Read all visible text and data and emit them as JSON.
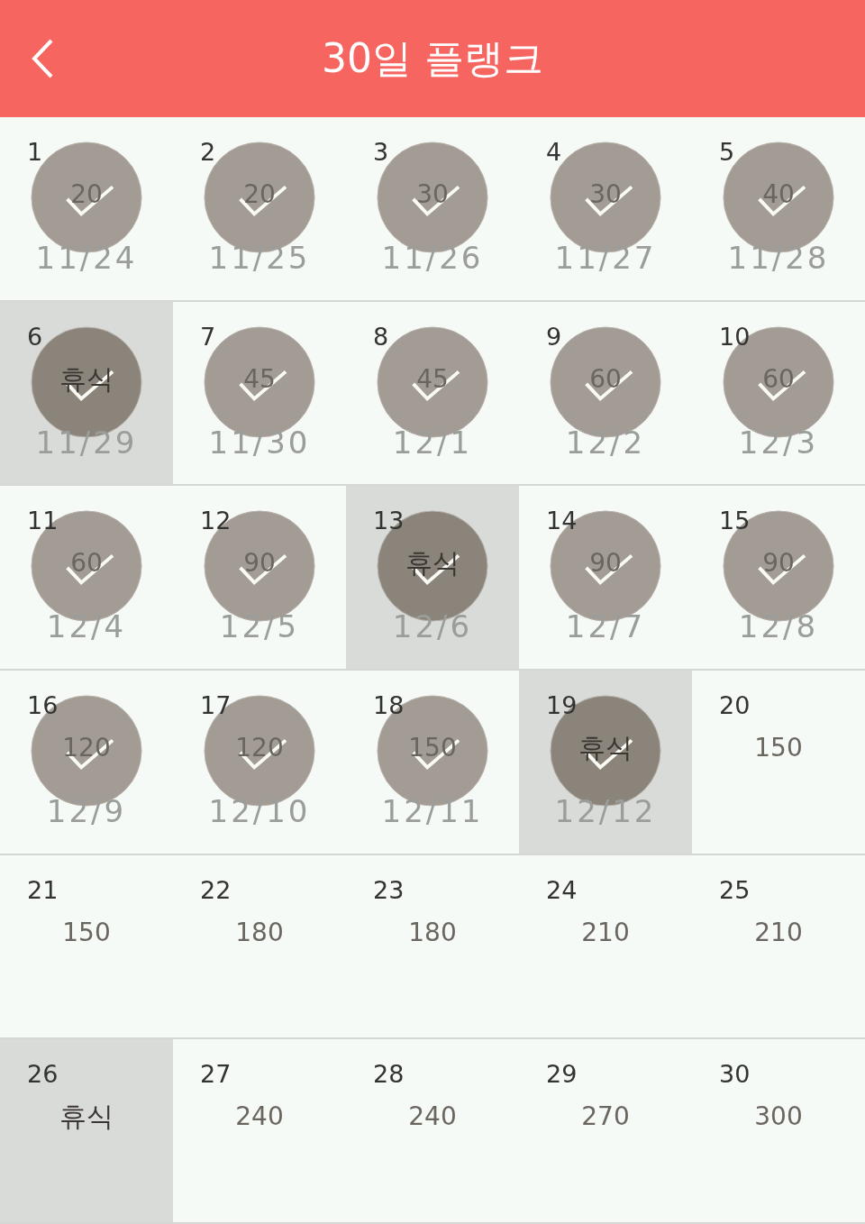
{
  "header": {
    "title": "30일 플랭크"
  },
  "days": [
    {
      "day": "1",
      "goal": "20",
      "date": "11/24",
      "done": true,
      "rest": false
    },
    {
      "day": "2",
      "goal": "20",
      "date": "11/25",
      "done": true,
      "rest": false
    },
    {
      "day": "3",
      "goal": "30",
      "date": "11/26",
      "done": true,
      "rest": false
    },
    {
      "day": "4",
      "goal": "30",
      "date": "11/27",
      "done": true,
      "rest": false
    },
    {
      "day": "5",
      "goal": "40",
      "date": "11/28",
      "done": true,
      "rest": false
    },
    {
      "day": "6",
      "goal": "휴식",
      "date": "11/29",
      "done": true,
      "rest": true
    },
    {
      "day": "7",
      "goal": "45",
      "date": "11/30",
      "done": true,
      "rest": false
    },
    {
      "day": "8",
      "goal": "45",
      "date": "12/1",
      "done": true,
      "rest": false
    },
    {
      "day": "9",
      "goal": "60",
      "date": "12/2",
      "done": true,
      "rest": false
    },
    {
      "day": "10",
      "goal": "60",
      "date": "12/3",
      "done": true,
      "rest": false
    },
    {
      "day": "11",
      "goal": "60",
      "date": "12/4",
      "done": true,
      "rest": false
    },
    {
      "day": "12",
      "goal": "90",
      "date": "12/5",
      "done": true,
      "rest": false
    },
    {
      "day": "13",
      "goal": "휴식",
      "date": "12/6",
      "done": true,
      "rest": true
    },
    {
      "day": "14",
      "goal": "90",
      "date": "12/7",
      "done": true,
      "rest": false
    },
    {
      "day": "15",
      "goal": "90",
      "date": "12/8",
      "done": true,
      "rest": false
    },
    {
      "day": "16",
      "goal": "120",
      "date": "12/9",
      "done": true,
      "rest": false
    },
    {
      "day": "17",
      "goal": "120",
      "date": "12/10",
      "done": true,
      "rest": false
    },
    {
      "day": "18",
      "goal": "150",
      "date": "12/11",
      "done": true,
      "rest": false
    },
    {
      "day": "19",
      "goal": "휴식",
      "date": "12/12",
      "done": true,
      "rest": true
    },
    {
      "day": "20",
      "goal": "150",
      "done": false,
      "rest": false
    },
    {
      "day": "21",
      "goal": "150",
      "done": false,
      "rest": false
    },
    {
      "day": "22",
      "goal": "180",
      "done": false,
      "rest": false
    },
    {
      "day": "23",
      "goal": "180",
      "done": false,
      "rest": false
    },
    {
      "day": "24",
      "goal": "210",
      "done": false,
      "rest": false
    },
    {
      "day": "25",
      "goal": "210",
      "done": false,
      "rest": false
    },
    {
      "day": "26",
      "goal": "휴식",
      "done": false,
      "rest": true
    },
    {
      "day": "27",
      "goal": "240",
      "done": false,
      "rest": false
    },
    {
      "day": "28",
      "goal": "240",
      "done": false,
      "rest": false
    },
    {
      "day": "29",
      "goal": "270",
      "done": false,
      "rest": false
    },
    {
      "day": "30",
      "goal": "300",
      "done": false,
      "rest": false
    }
  ]
}
